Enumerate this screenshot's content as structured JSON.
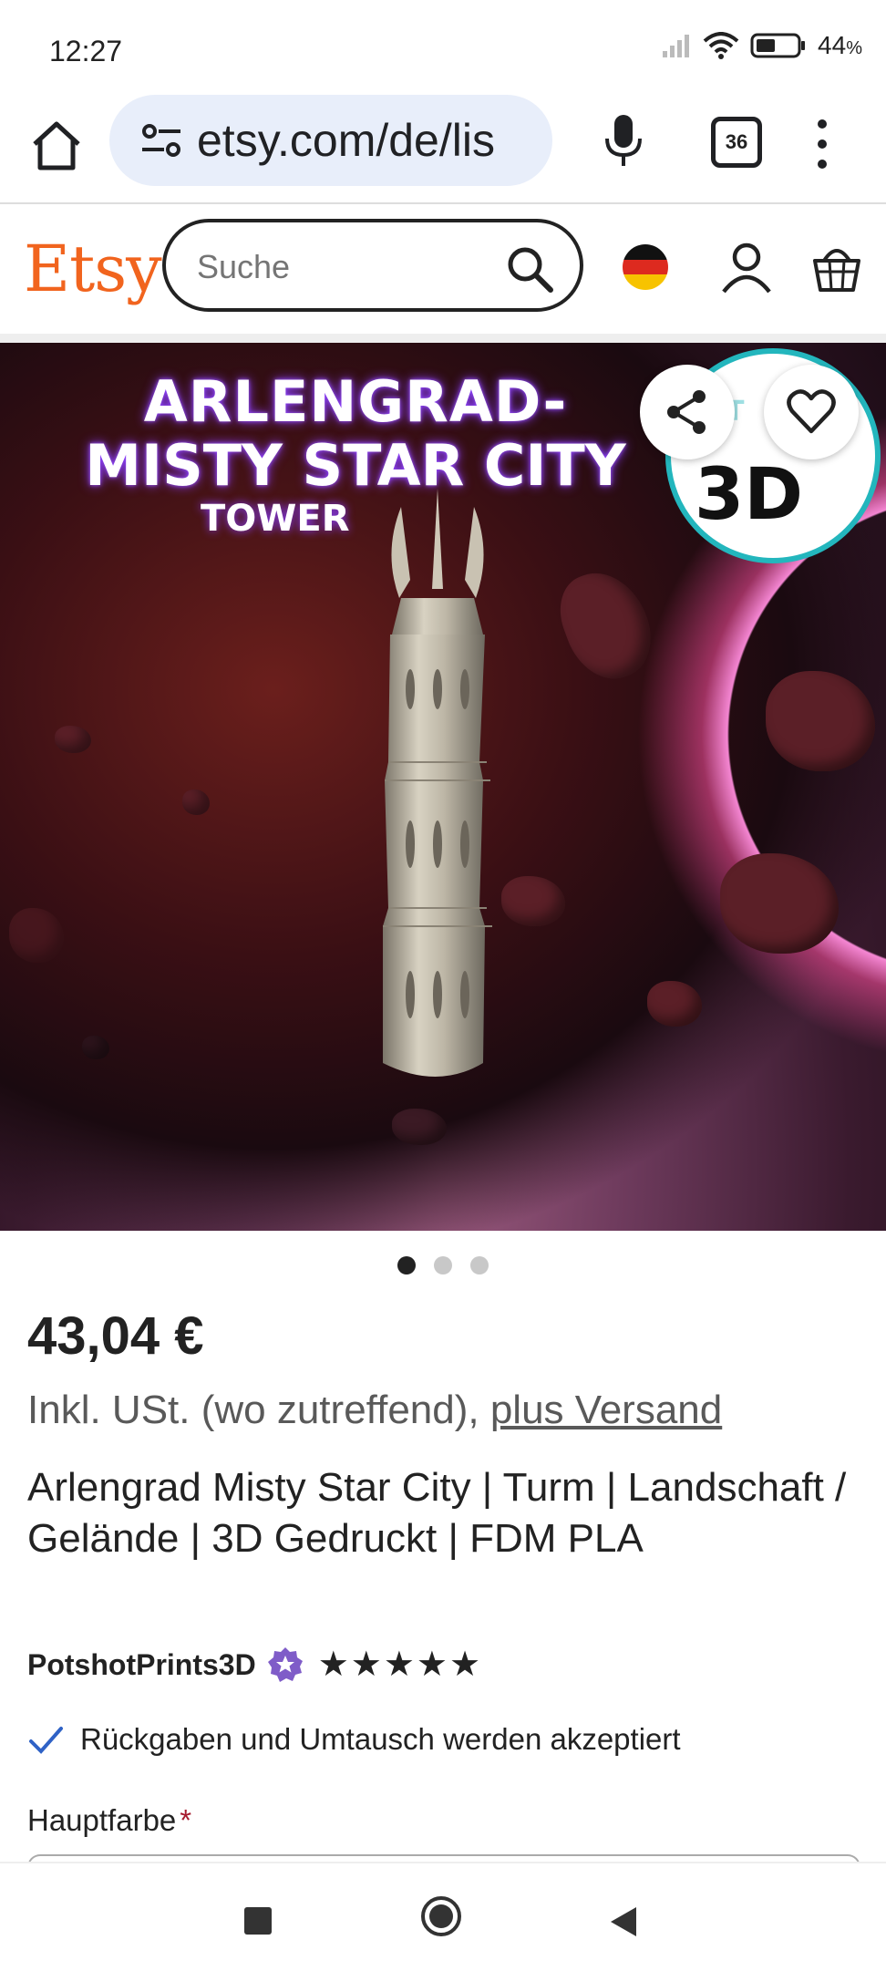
{
  "status_bar": {
    "time": "12:27",
    "battery": "44",
    "battery_unit": "%"
  },
  "browser": {
    "url": "etsy.com/de/lis",
    "tab_count": "36"
  },
  "header": {
    "logo": "Etsy",
    "search_placeholder": "Suche"
  },
  "hero": {
    "title_line1": "ARLENGRAD-",
    "title_line2": "MISTY STAR CITY",
    "title_line3": "TOWER",
    "badge_text": "3D",
    "image_index": 1,
    "image_count": 3
  },
  "product": {
    "price": "43,04 €",
    "tax_note": "Inkl. USt. (wo zutreffend), ",
    "shipping_link": "plus Versand",
    "title": "Arlengrad Misty Star City | Turm | Landschaft / Gelände | 3D Gedruckt | FDM PLA",
    "shop_name": "PotshotPrints3D",
    "rating_stars": 5,
    "returns_text": "Rückgaben und Umtausch werden akzeptiert",
    "option_label": "Hauptfarbe",
    "required_marker": "*"
  },
  "colors": {
    "etsy_orange": "#f1641e",
    "star_seller_purple": "#7f5cc8",
    "required_red": "#a61a2e",
    "check_blue": "#2f62c6"
  },
  "icons": [
    "home-icon",
    "site-settings-icon",
    "mic-icon",
    "tab-switcher-icon",
    "overflow-menu-icon",
    "search-icon",
    "flag-de-icon",
    "user-icon",
    "basket-icon",
    "share-icon",
    "heart-icon",
    "star-seller-icon",
    "star-icon",
    "check-icon",
    "nav-recents-icon",
    "nav-home-icon",
    "nav-back-icon"
  ]
}
